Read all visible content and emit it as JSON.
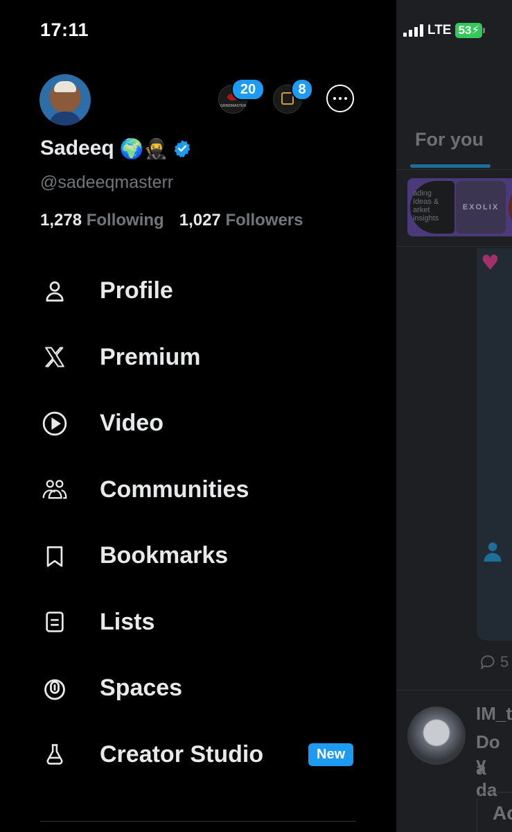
{
  "status_bar": {
    "time": "17:11",
    "network": "LTE",
    "battery": "53"
  },
  "header": {
    "account_badges": [
      "20",
      "8"
    ],
    "account1_text": "GRINDMASTER"
  },
  "profile": {
    "name": "Sadeeq",
    "name_emojis": "🌍🥷",
    "handle": "@sadeeqmasterr",
    "following_count": "1,278",
    "following_label": "Following",
    "followers_count": "1,027",
    "followers_label": "Followers"
  },
  "menu": [
    {
      "label": "Profile",
      "icon": "person-icon"
    },
    {
      "label": "Premium",
      "icon": "x-logo-icon"
    },
    {
      "label": "Video",
      "icon": "play-icon"
    },
    {
      "label": "Communities",
      "icon": "people-icon"
    },
    {
      "label": "Bookmarks",
      "icon": "bookmark-icon"
    },
    {
      "label": "Lists",
      "icon": "list-icon"
    },
    {
      "label": "Spaces",
      "icon": "spaces-icon"
    },
    {
      "label": "Creator Studio",
      "icon": "flask-icon",
      "badge": "New"
    }
  ],
  "feed": {
    "tab": "For you",
    "promo_texts": [
      "ading Ideas &",
      "arket insights",
      "EXOLIX"
    ],
    "comment_count": "5",
    "author": "IM_t",
    "tweet_line1": "Do y",
    "tweet_line2": "a da",
    "reply_prefix": "Ac"
  },
  "colors": {
    "accent": "#1d9bf0",
    "background": "#000000",
    "muted": "#71767b",
    "battery": "#34c759"
  }
}
